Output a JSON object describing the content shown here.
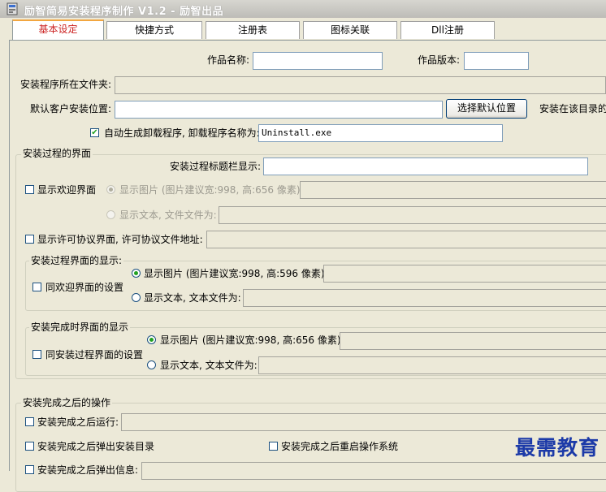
{
  "window": {
    "title": "励智简易安装程序制作 V1.2 - 励智出品"
  },
  "tabs": [
    "基本设定",
    "快捷方式",
    "注册表",
    "图标关联",
    "Dll注册"
  ],
  "form": {
    "work_name_label": "作品名称:",
    "work_version_label": "作品版本:",
    "installer_folder_label": "安装程序所在文件夹:",
    "default_location_label": "默认客户安装位置:",
    "choose_default_button": "选择默认位置",
    "install_in_dir_label": "安装在该目录的",
    "auto_uninstall_label": "自动生成卸载程序, 卸载程序名称为:",
    "auto_uninstall_checked": true,
    "uninstall_name_value": "Uninstall.exe"
  },
  "install_ui_group": {
    "title": "安装过程的界面",
    "titlebar_label": "安装过程标题栏显示:",
    "welcome_label": "显示欢迎界面",
    "welcome_image_label": "显示图片 (图片建议宽:998, 高:656 像素):",
    "welcome_text_label": "显示文本, 文件文件为:",
    "license_label": "显示许可协议界面, 许可协议文件地址:"
  },
  "process_group": {
    "title": "安装过程界面的显示:",
    "same_as_welcome_label": "同欢迎界面的设置",
    "image_label": "显示图片 (图片建议宽:998, 高:596 像素):",
    "text_label": "显示文本, 文本文件为:"
  },
  "finish_group": {
    "title": "安装完成时界面的显示",
    "same_as_process_label": "同安装过程界面的设置",
    "image_label": "显示图片 (图片建议宽:998, 高:656 像素):",
    "text_label": "显示文本, 文本文件为:"
  },
  "after_group": {
    "title": "安装完成之后的操作",
    "run_label": "安装完成之后运行:",
    "popup_dir_label": "安装完成之后弹出安装目录",
    "reboot_label": "安装完成之后重启操作系统",
    "popup_info_label": "安装完成之后弹出信息:"
  },
  "watermark": "最需教育"
}
